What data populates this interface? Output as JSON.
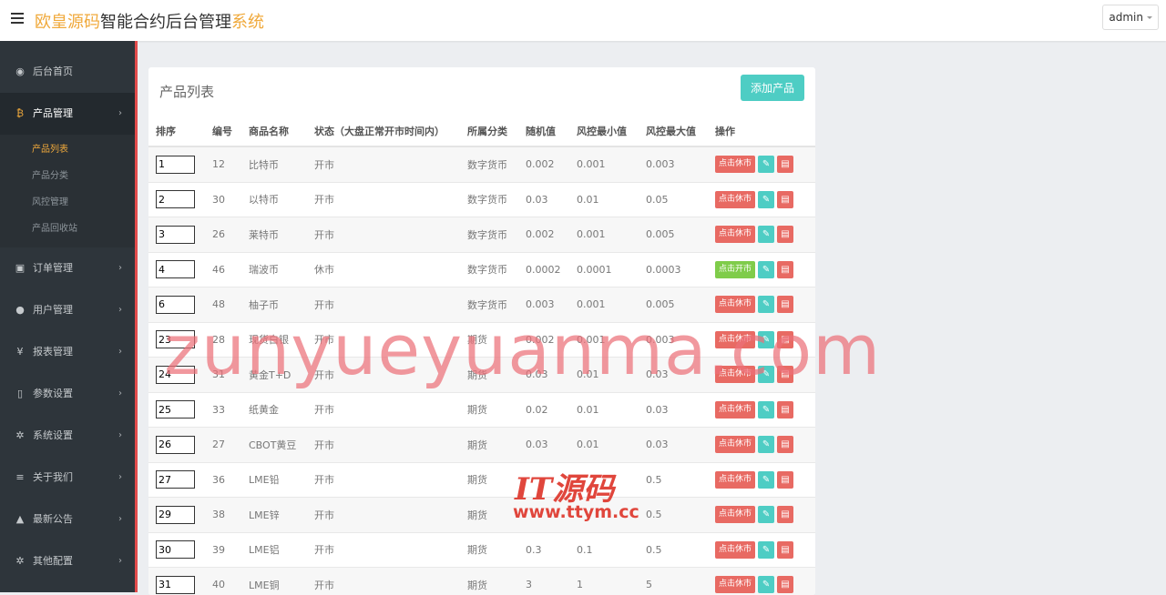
{
  "header": {
    "brand_part1": "欧皇源码",
    "brand_part2": "智能合约后台管理",
    "brand_part3": "系统",
    "user": "admin"
  },
  "sidebar": {
    "items": [
      {
        "label": "后台首页",
        "icon": "dashboard-icon",
        "glyph": "◉"
      },
      {
        "label": "产品管理",
        "icon": "bitcoin-icon",
        "glyph": "₿"
      },
      {
        "label": "订单管理",
        "icon": "copy-icon",
        "glyph": "▣"
      },
      {
        "label": "用户管理",
        "icon": "user-icon",
        "glyph": "●"
      },
      {
        "label": "报表管理",
        "icon": "yen-icon",
        "glyph": "¥"
      },
      {
        "label": "参数设置",
        "icon": "file-icon",
        "glyph": "▯"
      },
      {
        "label": "系统设置",
        "icon": "gears-icon",
        "glyph": "✲"
      },
      {
        "label": "关于我们",
        "icon": "list-icon",
        "glyph": "≡"
      },
      {
        "label": "最新公告",
        "icon": "bell-icon",
        "glyph": "▲"
      },
      {
        "label": "其他配置",
        "icon": "gear-icon",
        "glyph": "✲"
      }
    ],
    "product_submenu": [
      "产品列表",
      "产品分类",
      "风控管理",
      "产品回收站"
    ]
  },
  "main": {
    "title": "产品列表",
    "add_button": "添加产品",
    "columns": [
      "排序",
      "编号",
      "商品名称",
      "状态（大盘正常开市时间内）",
      "所属分类",
      "随机值",
      "风控最小值",
      "风控最大值",
      "操作"
    ],
    "rows": [
      {
        "sort": "1",
        "id": "12",
        "name": "比特币",
        "status": "开市",
        "category": "数字货币",
        "random": "0.002",
        "min": "0.001",
        "max": "0.003",
        "action": "点击休市"
      },
      {
        "sort": "2",
        "id": "30",
        "name": "以特币",
        "status": "开市",
        "category": "数字货币",
        "random": "0.03",
        "min": "0.01",
        "max": "0.05",
        "action": "点击休市"
      },
      {
        "sort": "3",
        "id": "26",
        "name": "莱特币",
        "status": "开市",
        "category": "数字货币",
        "random": "0.002",
        "min": "0.001",
        "max": "0.005",
        "action": "点击休市"
      },
      {
        "sort": "4",
        "id": "46",
        "name": "瑞波币",
        "status": "休市",
        "category": "数字货币",
        "random": "0.0002",
        "min": "0.0001",
        "max": "0.0003",
        "action": "点击开市"
      },
      {
        "sort": "6",
        "id": "48",
        "name": "柚子币",
        "status": "开市",
        "category": "数字货币",
        "random": "0.003",
        "min": "0.001",
        "max": "0.005",
        "action": "点击休市"
      },
      {
        "sort": "23",
        "id": "28",
        "name": "现货白银",
        "status": "开市",
        "category": "期货",
        "random": "0.002",
        "min": "0.001",
        "max": "0.003",
        "action": "点击休市"
      },
      {
        "sort": "24",
        "id": "31",
        "name": "黄金T+D",
        "status": "开市",
        "category": "期货",
        "random": "0.03",
        "min": "0.01",
        "max": "0.03",
        "action": "点击休市"
      },
      {
        "sort": "25",
        "id": "33",
        "name": "纸黄金",
        "status": "开市",
        "category": "期货",
        "random": "0.02",
        "min": "0.01",
        "max": "0.03",
        "action": "点击休市"
      },
      {
        "sort": "26",
        "id": "27",
        "name": "CBOT黄豆",
        "status": "开市",
        "category": "期货",
        "random": "0.03",
        "min": "0.01",
        "max": "0.03",
        "action": "点击休市"
      },
      {
        "sort": "27",
        "id": "36",
        "name": "LME铅",
        "status": "开市",
        "category": "期货",
        "random": "",
        "min": "",
        "max": "0.5",
        "action": "点击休市"
      },
      {
        "sort": "29",
        "id": "38",
        "name": "LME锌",
        "status": "开市",
        "category": "期货",
        "random": "",
        "min": "",
        "max": "0.5",
        "action": "点击休市"
      },
      {
        "sort": "30",
        "id": "39",
        "name": "LME铝",
        "status": "开市",
        "category": "期货",
        "random": "0.3",
        "min": "0.1",
        "max": "0.5",
        "action": "点击休市"
      },
      {
        "sort": "31",
        "id": "40",
        "name": "LME铜",
        "status": "开市",
        "category": "期货",
        "random": "3",
        "min": "1",
        "max": "5",
        "action": "点击休市"
      }
    ]
  },
  "watermark": {
    "line1": "zunyueyuanma.com",
    "line2": "IT源码",
    "line3": "www.ttym.cc"
  },
  "colors": {
    "accent_orange": "#f0a93b",
    "teal": "#4ecdc4",
    "red": "#e86a63",
    "green": "#7fcc4a",
    "sidebar_bg": "#2e353b"
  }
}
